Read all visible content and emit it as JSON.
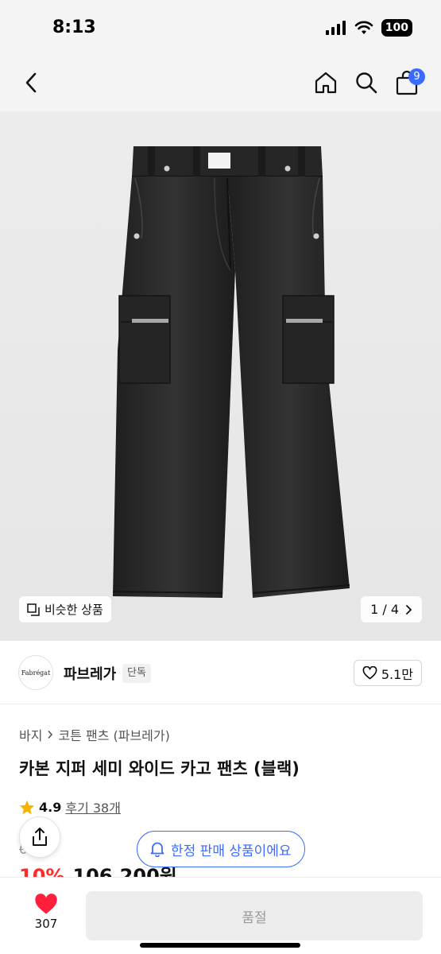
{
  "status": {
    "time": "8:13",
    "battery": "100"
  },
  "nav": {
    "cart_count": "9"
  },
  "hero": {
    "similar_label": "비슷한 상품",
    "pager_label": "1 / 4"
  },
  "brand": {
    "logo_text": "Fabrégat",
    "name": "파브레가",
    "badge": "단독",
    "likes": "5.1만"
  },
  "breadcrumb": {
    "category": "바지",
    "subcategory": "코튼 팬츠 (파브레가)"
  },
  "product": {
    "title": "카본 지퍼 세미 와이드 카고 팬츠 (블랙)",
    "rating": "4.9",
    "review_label": "후기 38개",
    "original_price": "0원",
    "discount": "10%",
    "sale_price": "106,200원"
  },
  "limited_notice": "한정 판매 상품이에요",
  "bottom": {
    "wish_count": "307",
    "soldout_label": "품절"
  },
  "colors": {
    "accent": "#3b6bff",
    "discount": "#ff2b2b",
    "heart": "#ff1e3c",
    "star": "#f5b300",
    "garment": "#2a2a2a"
  },
  "icons": {
    "back": "chevron-left-icon",
    "home": "home-icon",
    "search": "search-icon",
    "cart": "shopping-bag-icon",
    "similar": "copy-icon",
    "pager_next": "chevron-right-icon",
    "like": "heart-outline-icon",
    "star": "star-icon",
    "share": "share-icon",
    "bell": "bell-icon",
    "wish": "heart-filled-icon"
  }
}
